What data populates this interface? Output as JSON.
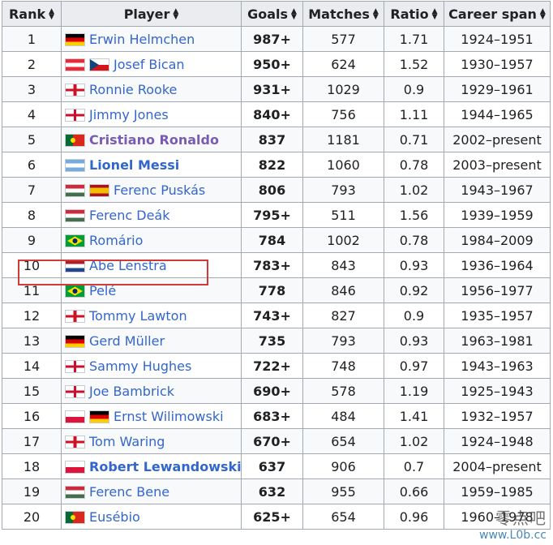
{
  "headers": {
    "rank": "Rank",
    "player": "Player",
    "goals": "Goals",
    "matches": "Matches",
    "ratio": "Ratio",
    "span": "Career span"
  },
  "rows": [
    {
      "rank": "1",
      "flags": [
        "flag-germany-icon"
      ],
      "player": "Erwin Helmchen",
      "goals": "987+",
      "matches": "577",
      "ratio": "1.71",
      "span": "1924–1951"
    },
    {
      "rank": "2",
      "flags": [
        "flag-austria-icon",
        "flag-czechia-icon"
      ],
      "player": "Josef Bican",
      "goals": "950+",
      "matches": "624",
      "ratio": "1.52",
      "span": "1930–1957"
    },
    {
      "rank": "3",
      "flags": [
        "flag-england-icon"
      ],
      "player": "Ronnie Rooke",
      "goals": "931+",
      "matches": "1029",
      "ratio": "0.9",
      "span": "1929–1961"
    },
    {
      "rank": "4",
      "flags": [
        "flag-northern-ireland-icon"
      ],
      "player": "Jimmy Jones",
      "goals": "840+",
      "matches": "756",
      "ratio": "1.11",
      "span": "1944–1965"
    },
    {
      "rank": "5",
      "flags": [
        "flag-portugal-icon"
      ],
      "player": "Cristiano Ronaldo",
      "goals": "837",
      "matches": "1181",
      "ratio": "0.71",
      "span": "2002–present"
    },
    {
      "rank": "6",
      "flags": [
        "flag-argentina-icon"
      ],
      "player": "Lionel Messi",
      "goals": "822",
      "matches": "1060",
      "ratio": "0.78",
      "span": "2003–present"
    },
    {
      "rank": "7",
      "flags": [
        "flag-hungary-icon",
        "flag-spain-icon"
      ],
      "player": "Ferenc Puskás",
      "goals": "806",
      "matches": "793",
      "ratio": "1.02",
      "span": "1943–1967"
    },
    {
      "rank": "8",
      "flags": [
        "flag-hungary-icon"
      ],
      "player": "Ferenc Deák",
      "goals": "795+",
      "matches": "511",
      "ratio": "1.56",
      "span": "1939–1959"
    },
    {
      "rank": "9",
      "flags": [
        "flag-brazil-icon"
      ],
      "player": "Romário",
      "goals": "784",
      "matches": "1002",
      "ratio": "0.78",
      "span": "1984–2009"
    },
    {
      "rank": "10",
      "flags": [
        "flag-netherlands-icon"
      ],
      "player": "Abe Lenstra",
      "goals": "783+",
      "matches": "843",
      "ratio": "0.93",
      "span": "1936–1964"
    },
    {
      "rank": "11",
      "flags": [
        "flag-brazil-icon"
      ],
      "player": "Pelé",
      "goals": "778",
      "matches": "846",
      "ratio": "0.92",
      "span": "1956–1977"
    },
    {
      "rank": "12",
      "flags": [
        "flag-england-icon"
      ],
      "player": "Tommy Lawton",
      "goals": "743+",
      "matches": "827",
      "ratio": "0.9",
      "span": "1935–1957"
    },
    {
      "rank": "13",
      "flags": [
        "flag-germany-icon"
      ],
      "player": "Gerd Müller",
      "goals": "735",
      "matches": "793",
      "ratio": "0.93",
      "span": "1963–1981"
    },
    {
      "rank": "14",
      "flags": [
        "flag-northern-ireland-icon"
      ],
      "player": "Sammy Hughes",
      "goals": "722+",
      "matches": "748",
      "ratio": "0.97",
      "span": "1943–1963"
    },
    {
      "rank": "15",
      "flags": [
        "flag-northern-ireland-icon"
      ],
      "player": "Joe Bambrick",
      "goals": "690+",
      "matches": "578",
      "ratio": "1.19",
      "span": "1925–1943"
    },
    {
      "rank": "16",
      "flags": [
        "flag-poland-icon",
        "flag-germany-icon"
      ],
      "player": "Ernst Wilimowski",
      "goals": "683+",
      "matches": "484",
      "ratio": "1.41",
      "span": "1932–1957"
    },
    {
      "rank": "17",
      "flags": [
        "flag-england-icon"
      ],
      "player": "Tom Waring",
      "goals": "670+",
      "matches": "654",
      "ratio": "1.02",
      "span": "1924–1948"
    },
    {
      "rank": "18",
      "flags": [
        "flag-poland-icon"
      ],
      "player": "Robert Lewandowski",
      "goals": "637",
      "matches": "906",
      "ratio": "0.7",
      "span": "2004–present"
    },
    {
      "rank": "19",
      "flags": [
        "flag-hungary-icon"
      ],
      "player": "Ferenc Bene",
      "goals": "632",
      "matches": "955",
      "ratio": "0.66",
      "span": "1959–1985"
    },
    {
      "rank": "20",
      "flags": [
        "flag-portugal-icon"
      ],
      "player": "Eusébio",
      "goals": "625+",
      "matches": "654",
      "ratio": "0.96",
      "span": "1960–1978"
    }
  ],
  "bold_players": [
    "Cristiano Ronaldo",
    "Lionel Messi",
    "Robert Lewandowski"
  ],
  "visited_players": [
    "Cristiano Ronaldo"
  ],
  "highlighted_rank": "10",
  "highlight_color": "#d23a3a",
  "link_color": "#3366cc",
  "visited_color": "#795cb2",
  "watermark": {
    "text": "零点吧",
    "url": "www.L0b.cc"
  }
}
